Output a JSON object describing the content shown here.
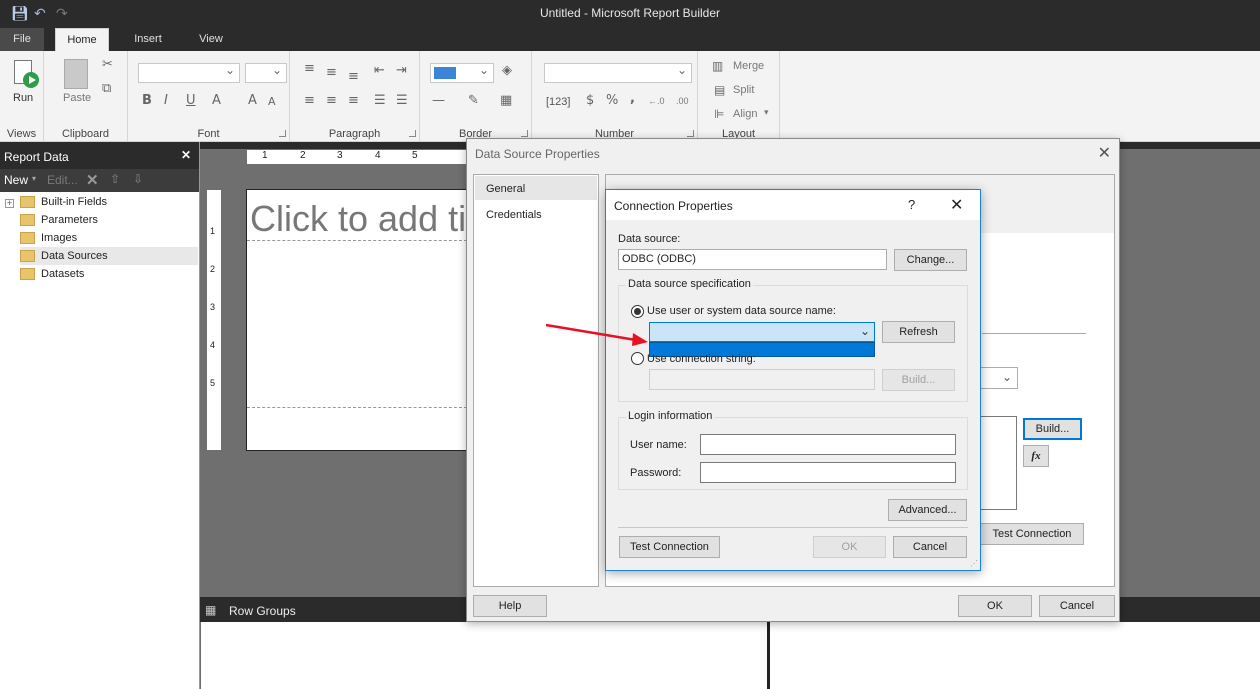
{
  "window": {
    "title": "Untitled - Microsoft Report Builder"
  },
  "ribbon_tabs": [
    "File",
    "Home",
    "Insert",
    "View"
  ],
  "ribbon": {
    "groups": {
      "views": "Views",
      "clipboard": "Clipboard",
      "font": "Font",
      "paragraph": "Paragraph",
      "border": "Border",
      "number": "Number",
      "layout": "Layout"
    },
    "run_label": "Run",
    "paste_label": "Paste",
    "bold": "B",
    "italic": "I",
    "underline": "U",
    "font_color": "A",
    "grow_font": "A",
    "shrink_font": "A",
    "merge_label": "Merge",
    "split_label": "Split",
    "align_label": "Align",
    "number_placeholders": "[123]",
    "currency": "$",
    "percent": "%",
    "comma": ",",
    "inc_decimal": "←.0",
    "dec_decimal": ".00"
  },
  "report_data": {
    "title": "Report Data",
    "close": "✕",
    "toolbar": {
      "new": "New",
      "edit": "Edit..."
    },
    "items": [
      {
        "label": "Built-in Fields",
        "expand": "+"
      },
      {
        "label": "Parameters"
      },
      {
        "label": "Images"
      },
      {
        "label": "Data Sources",
        "selected": true
      },
      {
        "label": "Datasets"
      }
    ]
  },
  "ruler": {
    "h": [
      "1",
      "2",
      "3",
      "4",
      "5"
    ],
    "v": [
      "1",
      "2",
      "3",
      "4",
      "5"
    ]
  },
  "report": {
    "title_placeholder": "Click to add title"
  },
  "row_groups": {
    "label": "Row Groups"
  },
  "ds_dialog": {
    "title": "Data Source Properties",
    "nav": [
      "General",
      "Credentials"
    ],
    "build": "Build...",
    "fx": "fx",
    "test_connection": "Test Connection",
    "help": "Help",
    "ok": "OK",
    "cancel": "Cancel"
  },
  "conn_dialog": {
    "title": "Connection Properties",
    "help_glyph": "?",
    "data_source_label": "Data source:",
    "data_source_value": "ODBC (ODBC)",
    "change": "Change...",
    "spec_title": "Data source specification",
    "use_dsn": "Use user or system data source name:",
    "refresh": "Refresh",
    "use_conn_string": "Use connection string:",
    "build": "Build...",
    "login_title": "Login information",
    "user_name": "User name:",
    "password": "Password:",
    "advanced": "Advanced...",
    "test_connection": "Test Connection",
    "ok": "OK",
    "cancel": "Cancel"
  },
  "colors": {
    "accent": "#0078d7",
    "annotation_arrow": "#e81123"
  }
}
